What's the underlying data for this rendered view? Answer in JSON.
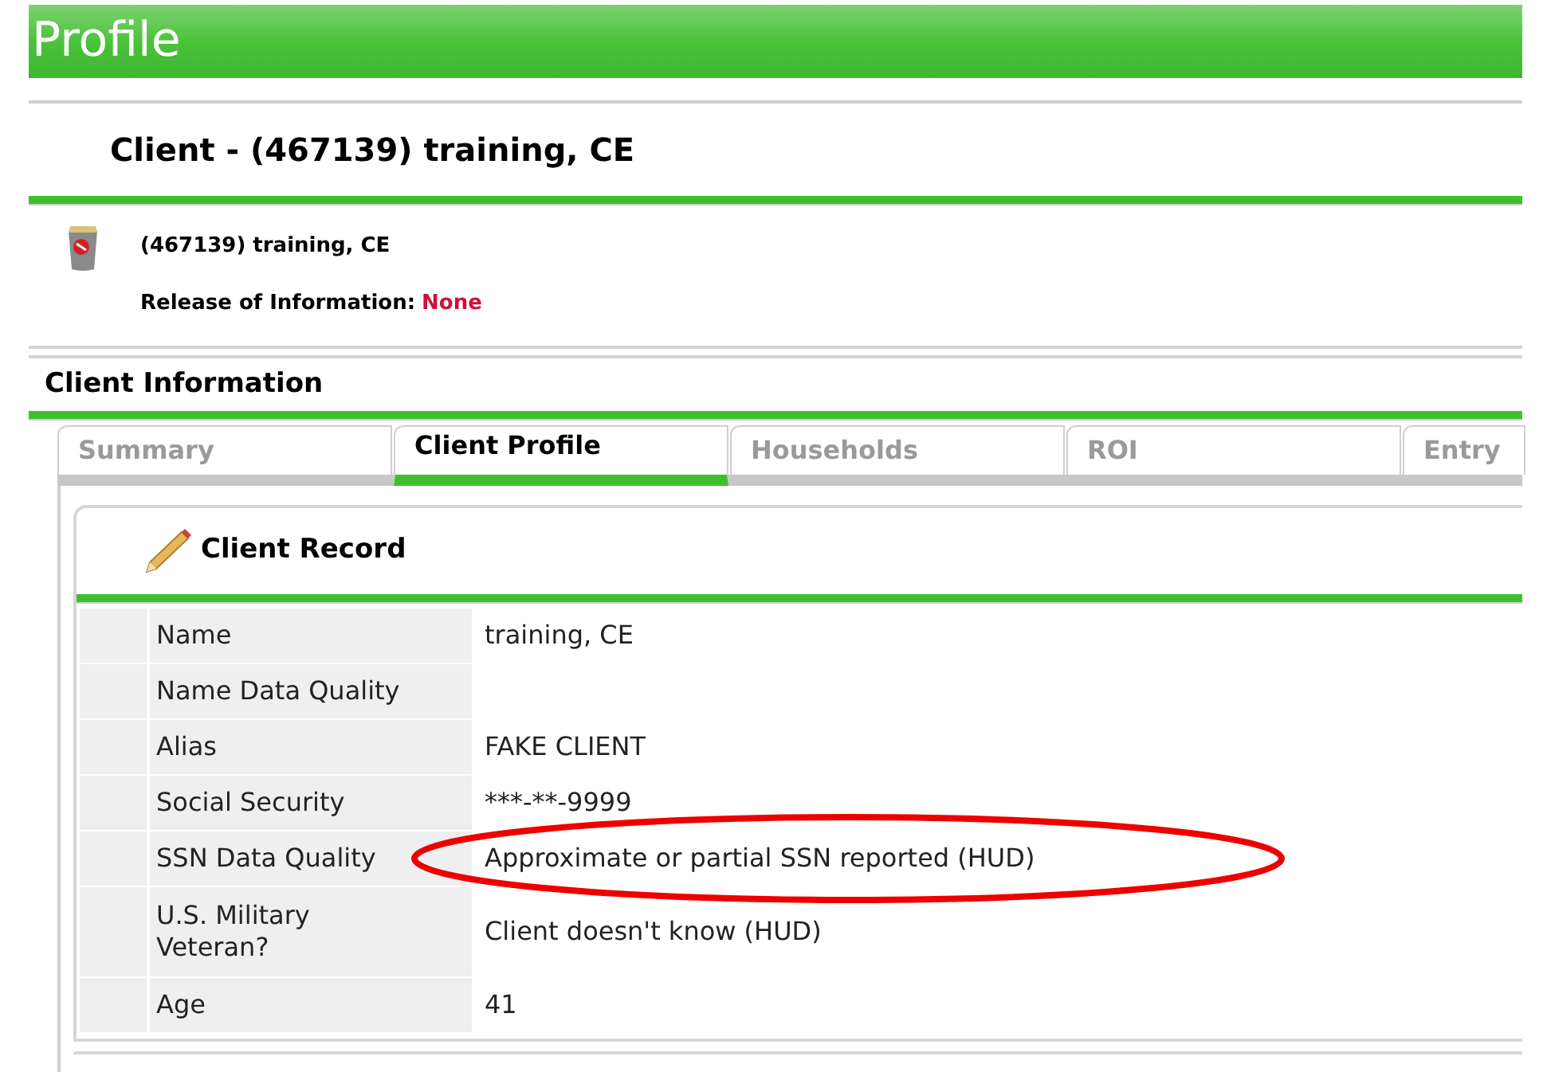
{
  "page_title": "Profile",
  "client_heading": "Client - (467139) training, CE",
  "client_summary": {
    "name": "(467139) training, CE",
    "roi_label": "Release of Information:",
    "roi_value": "None"
  },
  "section_title": "Client Information",
  "tabs": [
    {
      "label": "Summary",
      "selected": false
    },
    {
      "label": "Client Profile",
      "selected": true
    },
    {
      "label": "Households",
      "selected": false
    },
    {
      "label": "ROI",
      "selected": false
    },
    {
      "label": "Entry",
      "selected": false
    }
  ],
  "record": {
    "title": "Client Record",
    "rows": [
      {
        "label": "Name",
        "value": "training, CE",
        "circled": false
      },
      {
        "label": "Name Data Quality",
        "circled": false
      },
      {
        "label": "Alias",
        "value": "FAKE CLIENT",
        "circled": false
      },
      {
        "label": "Social Security",
        "value": "***-**-9999",
        "circled": false
      },
      {
        "label": "SSN Data Quality",
        "value": "Approximate or partial SSN reported (HUD)",
        "circled": true
      },
      {
        "label": "U.S. Military Veteran?",
        "value": "Client doesn't know (HUD)",
        "circled": false
      },
      {
        "label": "Age",
        "value": "41",
        "circled": false
      }
    ]
  }
}
